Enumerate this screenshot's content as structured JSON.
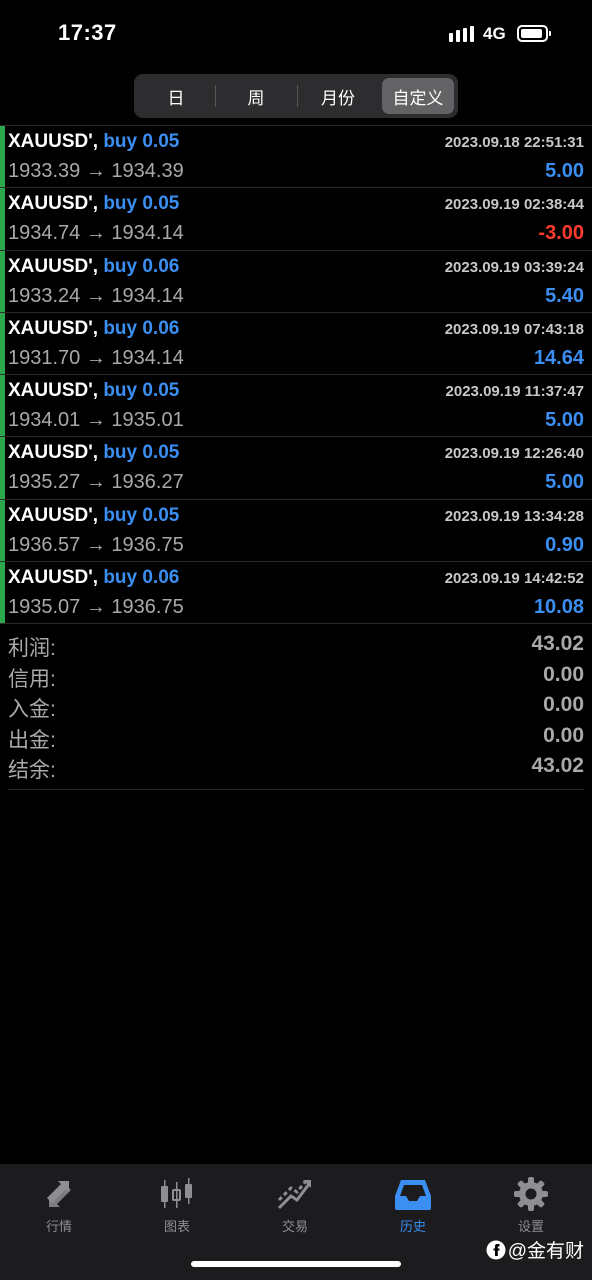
{
  "status": {
    "time": "17:37",
    "network": "4G"
  },
  "periods": [
    "日",
    "周",
    "月份",
    "自定义"
  ],
  "active_period": "自定义",
  "trades": [
    {
      "symbol": "XAUUSD'",
      "side": "buy 0.05",
      "date": "2023.09.18 22:51:31",
      "prices": "1933.39 → 1934.39",
      "profit": "5.00"
    },
    {
      "symbol": "XAUUSD'",
      "side": "buy 0.05",
      "date": "2023.09.19 02:38:44",
      "prices": "1934.74 → 1934.14",
      "profit": "-3.00"
    },
    {
      "symbol": "XAUUSD'",
      "side": "buy 0.06",
      "date": "2023.09.19 03:39:24",
      "prices": "1933.24 → 1934.14",
      "profit": "5.40"
    },
    {
      "symbol": "XAUUSD'",
      "side": "buy 0.06",
      "date": "2023.09.19 07:43:18",
      "prices": "1931.70 → 1934.14",
      "profit": "14.64"
    },
    {
      "symbol": "XAUUSD'",
      "side": "buy 0.05",
      "date": "2023.09.19 11:37:47",
      "prices": "1934.01 → 1935.01",
      "profit": "5.00"
    },
    {
      "symbol": "XAUUSD'",
      "side": "buy 0.05",
      "date": "2023.09.19 12:26:40",
      "prices": "1935.27 → 1936.27",
      "profit": "5.00"
    },
    {
      "symbol": "XAUUSD'",
      "side": "buy 0.05",
      "date": "2023.09.19 13:34:28",
      "prices": "1936.57 → 1936.75",
      "profit": "0.90"
    },
    {
      "symbol": "XAUUSD'",
      "side": "buy 0.06",
      "date": "2023.09.19 14:42:52",
      "prices": "1935.07 → 1936.75",
      "profit": "10.08"
    }
  ],
  "summary": [
    {
      "label": "利润:",
      "value": "43.02"
    },
    {
      "label": "信用:",
      "value": "0.00"
    },
    {
      "label": "入金:",
      "value": "0.00"
    },
    {
      "label": "出金:",
      "value": "0.00"
    },
    {
      "label": "结余:",
      "value": "43.02"
    }
  ],
  "tabs": [
    {
      "label": "行情",
      "icon": "quotes-icon"
    },
    {
      "label": "图表",
      "icon": "candlestick-icon"
    },
    {
      "label": "交易",
      "icon": "trade-icon"
    },
    {
      "label": "历史",
      "icon": "history-inbox-icon"
    },
    {
      "label": "设置",
      "icon": "gear-icon"
    }
  ],
  "active_tab": "历史",
  "watermark": "@金有财",
  "colors": {
    "accent_green": "#2ca84a",
    "buy_blue": "#3b8ef2",
    "loss_red": "#ff3b30",
    "muted_text": "#a9a9a9"
  }
}
